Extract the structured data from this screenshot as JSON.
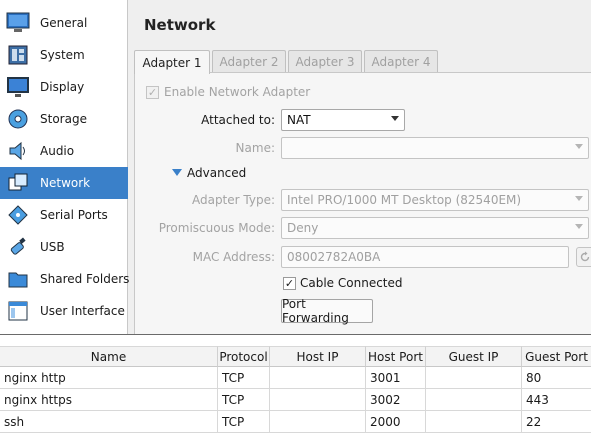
{
  "sidebar": {
    "items": [
      {
        "label": "General",
        "icon": "general-icon"
      },
      {
        "label": "System",
        "icon": "system-icon"
      },
      {
        "label": "Display",
        "icon": "display-icon"
      },
      {
        "label": "Storage",
        "icon": "storage-icon"
      },
      {
        "label": "Audio",
        "icon": "audio-icon"
      },
      {
        "label": "Network",
        "icon": "network-icon",
        "selected": true
      },
      {
        "label": "Serial Ports",
        "icon": "serial-ports-icon"
      },
      {
        "label": "USB",
        "icon": "usb-icon"
      },
      {
        "label": "Shared Folders",
        "icon": "shared-folders-icon"
      },
      {
        "label": "User Interface",
        "icon": "user-interface-icon"
      }
    ]
  },
  "header": {
    "title": "Network"
  },
  "tabs": [
    {
      "label": "Adapter 1",
      "active": true
    },
    {
      "label": "Adapter 2"
    },
    {
      "label": "Adapter 3"
    },
    {
      "label": "Adapter 4"
    }
  ],
  "adapter": {
    "enable_label": "Enable Network Adapter",
    "enable_checked": true,
    "attached_label": "Attached to:",
    "attached_value": "NAT",
    "name_label": "Name:",
    "name_value": "",
    "advanced_label": "Advanced",
    "adapter_type_label": "Adapter Type:",
    "adapter_type_value": "Intel PRO/1000 MT Desktop (82540EM)",
    "promiscuous_label": "Promiscuous Mode:",
    "promiscuous_value": "Deny",
    "mac_label": "MAC Address:",
    "mac_value": "08002782A0BA",
    "cable_label": "Cable Connected",
    "cable_checked": true,
    "port_forwarding_label": "Port Forwarding"
  },
  "port_table": {
    "columns": [
      "Name",
      "Protocol",
      "Host IP",
      "Host Port",
      "Guest IP",
      "Guest Port"
    ],
    "rows": [
      [
        "nginx http",
        "TCP",
        "",
        "3001",
        "",
        "80"
      ],
      [
        "nginx https",
        "TCP",
        "",
        "3002",
        "",
        "443"
      ],
      [
        "ssh",
        "TCP",
        "",
        "2000",
        "",
        "22"
      ]
    ]
  },
  "colors": {
    "accent": "#3a80c9"
  }
}
